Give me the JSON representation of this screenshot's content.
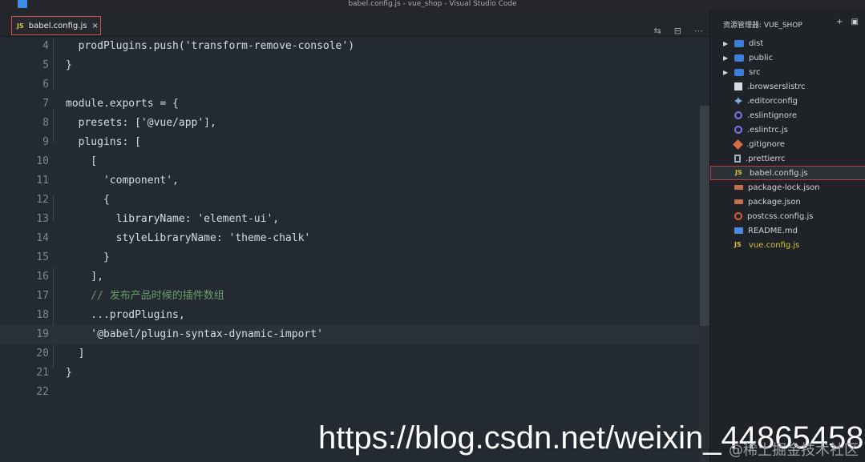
{
  "window": {
    "title": "babel.config.js - vue_shop - Visual Studio Code"
  },
  "tab": {
    "file": "babel.config.js",
    "language": "JS",
    "close": "×"
  },
  "toolbar": {
    "compare": "⇆",
    "split": "⊟",
    "more": "⋯"
  },
  "editor": {
    "lines": [
      {
        "num": "4",
        "text": "  prodPlugins.push('transform-remove-console')"
      },
      {
        "num": "5",
        "text": "}"
      },
      {
        "num": "6",
        "text": ""
      },
      {
        "num": "7",
        "text": "module.exports = {"
      },
      {
        "num": "8",
        "text": "  presets: ['@vue/app'],"
      },
      {
        "num": "9",
        "text": "  plugins: ["
      },
      {
        "num": "10",
        "text": "    ["
      },
      {
        "num": "11",
        "text": "      'component',"
      },
      {
        "num": "12",
        "text": "      {"
      },
      {
        "num": "13",
        "text": "        libraryName: 'element-ui',"
      },
      {
        "num": "14",
        "text": "        styleLibraryName: 'theme-chalk'"
      },
      {
        "num": "15",
        "text": "      }"
      },
      {
        "num": "16",
        "text": "    ],"
      },
      {
        "num": "17",
        "text": "    // 发布产品时候的插件数组"
      },
      {
        "num": "18",
        "text": "    ...prodPlugins,"
      },
      {
        "num": "19",
        "text": "    '@babel/plugin-syntax-dynamic-import'"
      },
      {
        "num": "20",
        "text": "  ]"
      },
      {
        "num": "21",
        "text": "}"
      },
      {
        "num": "22",
        "text": ""
      }
    ]
  },
  "explorer": {
    "title": "资源管理器: VUE_SHOP",
    "new_file": "+",
    "new_folder": "▣",
    "items": [
      {
        "label": "dist",
        "type": "folder"
      },
      {
        "label": "public",
        "type": "folder"
      },
      {
        "label": "src",
        "type": "folder"
      },
      {
        "label": ".browserslistrc",
        "type": "file"
      },
      {
        "label": ".editorconfig",
        "type": "file"
      },
      {
        "label": ".eslintignore",
        "type": "file"
      },
      {
        "label": ".eslintrc.js",
        "type": "file"
      },
      {
        "label": ".gitignore",
        "type": "file"
      },
      {
        "label": ".prettierrc",
        "type": "file"
      },
      {
        "label": "babel.config.js",
        "type": "file"
      },
      {
        "label": "package-lock.json",
        "type": "file"
      },
      {
        "label": "package.json",
        "type": "file"
      },
      {
        "label": "postcss.config.js",
        "type": "file"
      },
      {
        "label": "README.md",
        "type": "file"
      },
      {
        "label": "vue.config.js",
        "type": "file"
      }
    ]
  },
  "watermark": {
    "url": "https://blog.csdn.net/weixin_44865458",
    "sub": "@稀土掘金技术社区"
  }
}
